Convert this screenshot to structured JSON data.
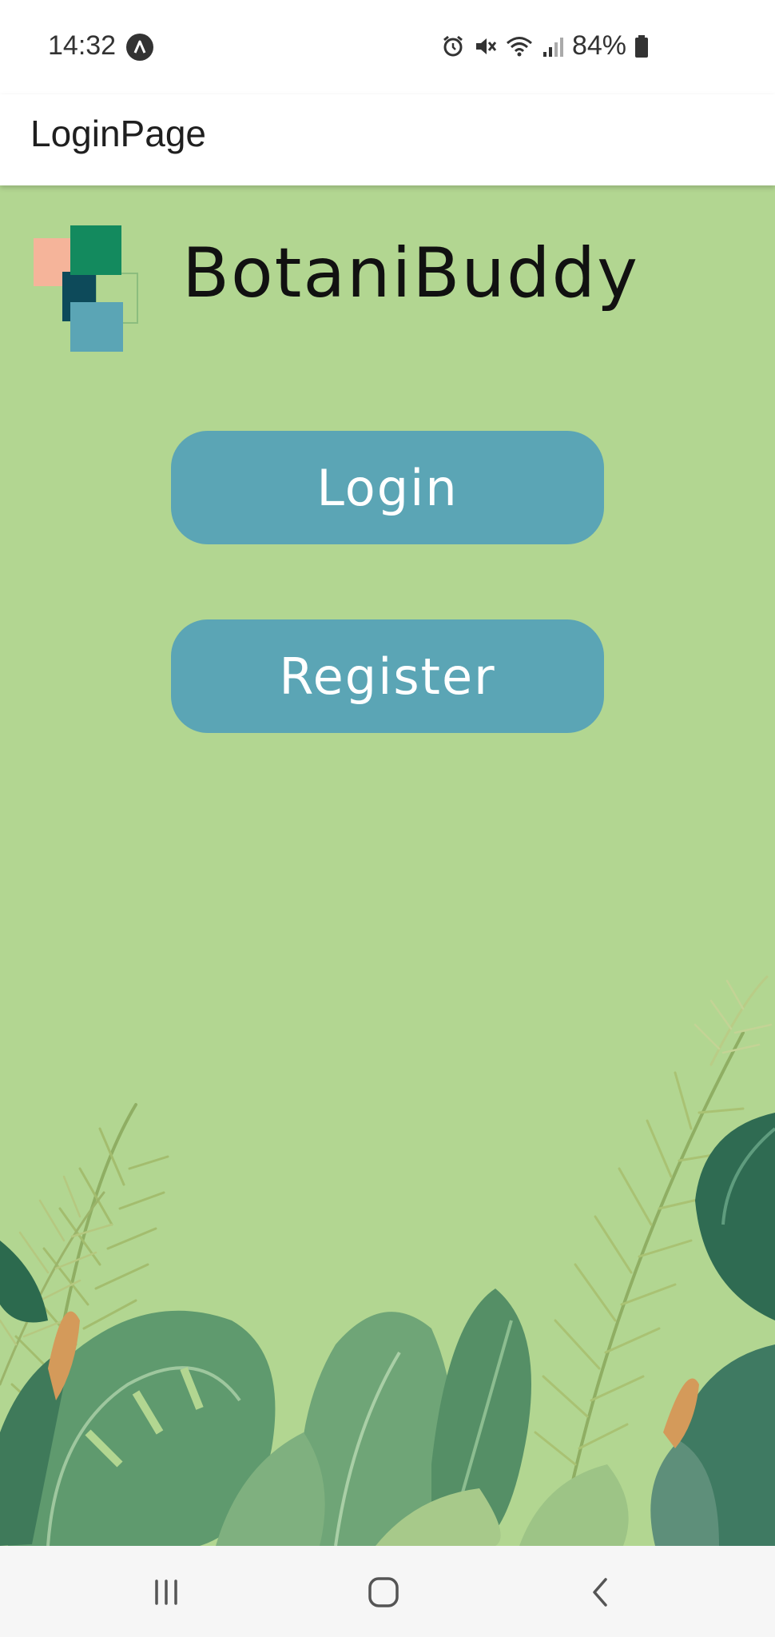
{
  "status_bar": {
    "time": "14:32",
    "battery_percent": "84%",
    "icons": [
      "app-notification-icon",
      "alarm-icon",
      "mute-icon",
      "wifi-icon",
      "signal-icon",
      "battery-icon"
    ]
  },
  "app_bar": {
    "title": "LoginPage"
  },
  "brand": {
    "name": "BotaniBuddy"
  },
  "buttons": {
    "login_label": "Login",
    "register_label": "Register"
  },
  "nav_bar": {
    "icons": [
      "recent-apps-icon",
      "home-icon",
      "back-icon"
    ]
  },
  "colors": {
    "background": "#b2d691",
    "button": "#5ba5b5",
    "logo_peach": "#f5b49a",
    "logo_green": "#138a5e",
    "logo_dark": "#0d4a5a",
    "logo_teal": "#5ba5b5"
  }
}
